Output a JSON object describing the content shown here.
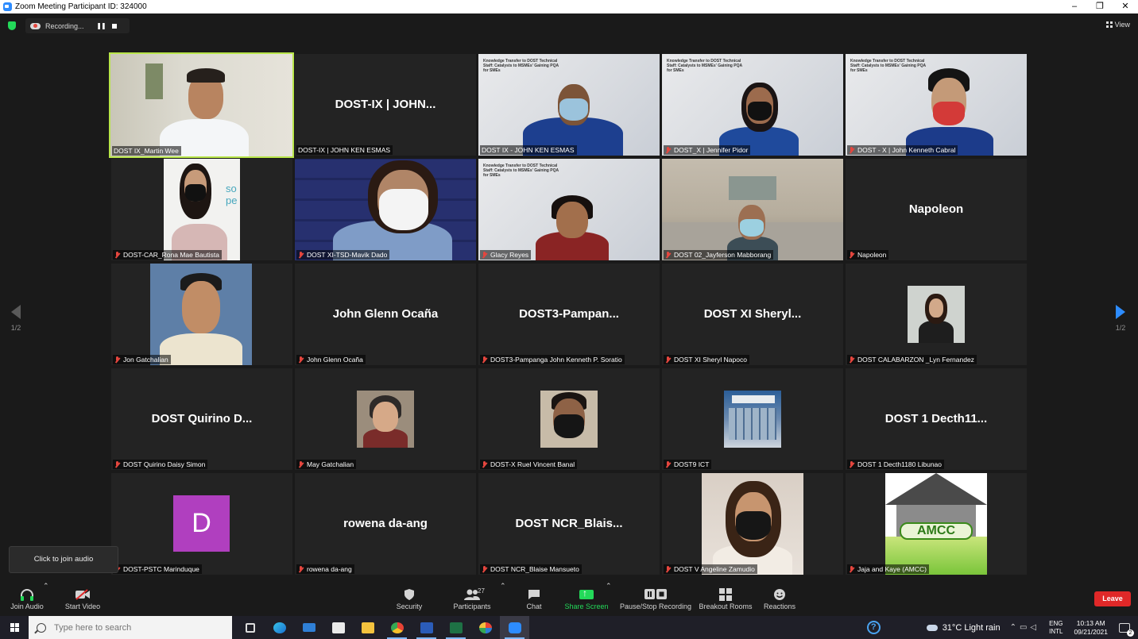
{
  "window": {
    "title": "Zoom Meeting Participant ID: 324000",
    "minimize": "–",
    "restore": "❐",
    "close": "✕"
  },
  "meeting": {
    "recording_label": "Recording...",
    "view_label": "View",
    "page_left": "1/2",
    "page_right": "1/2"
  },
  "tiles": [
    {
      "label": "DOST IX_Martin Wee",
      "bigname": ""
    },
    {
      "label": "DOST-IX | JOHN KEN ESMAS",
      "bigname": "DOST-IX | JOHN..."
    },
    {
      "label": "DOST IX - JOHN KEN ESMAS",
      "bigname": ""
    },
    {
      "label": "DOST_X | Jennifer Pidor",
      "bigname": ""
    },
    {
      "label": "DOST - X | John Kenneth Cabral",
      "bigname": ""
    },
    {
      "label": "DOST-CAR_Rona Mae Bautista",
      "bigname": ""
    },
    {
      "label": "DOST XI-TSD-Mavik Dado",
      "bigname": ""
    },
    {
      "label": "Glacy Reyes",
      "bigname": ""
    },
    {
      "label": "DOST 02_Jayferson Mabborang",
      "bigname": ""
    },
    {
      "label": "Napoleon",
      "bigname": "Napoleon"
    },
    {
      "label": "Jon Gatchalian",
      "bigname": ""
    },
    {
      "label": "John Glenn Ocaña",
      "bigname": "John Glenn Ocaña"
    },
    {
      "label": "DOST3-Pampanga John Kenneth P. Soratio",
      "bigname": "DOST3-Pampan..."
    },
    {
      "label": "DOST XI Sheryl Napoco",
      "bigname": "DOST  XI  Sheryl..."
    },
    {
      "label": "DOST CALABARZON _Lyn Fernandez",
      "bigname": ""
    },
    {
      "label": "DOST Quirino Daisy Simon",
      "bigname": "DOST  Quirino  D..."
    },
    {
      "label": "May Gatchalian",
      "bigname": ""
    },
    {
      "label": "DOST-X Ruel Vincent Banal",
      "bigname": ""
    },
    {
      "label": "DOST9 ICT",
      "bigname": ""
    },
    {
      "label": "DOST 1 Decth1180 Libunao",
      "bigname": "DOST  1  Decth11..."
    },
    {
      "label": "DOST-PSTC Marinduque",
      "bigname": ""
    },
    {
      "label": "rowena da-ang",
      "bigname": "rowena da-ang"
    },
    {
      "label": "DOST NCR_Blaise Mansueto",
      "bigname": "DOST  NCR_Blais..."
    },
    {
      "label": "DOST V Angeline Zamudio",
      "bigname": ""
    },
    {
      "label": "Jaja and Kaye (AMCC)",
      "bigname": ""
    }
  ],
  "slide_text": "Knowledge Transfer to DOST Technical Staff: Catalysts to MSMEs' Gaining PQA for SMEs",
  "avatar_letter": "D",
  "logo_text": "AMCC",
  "tooltip": "Click to join audio",
  "toolbar": {
    "join_audio": "Join Audio",
    "start_video": "Start Video",
    "security": "Security",
    "participants": "Participants",
    "participants_count": "27",
    "chat": "Chat",
    "share_screen": "Share Screen",
    "pause_recording": "Pause/Stop Recording",
    "breakout_rooms": "Breakout Rooms",
    "reactions": "Reactions",
    "leave": "Leave"
  },
  "taskbar": {
    "search_placeholder": "Type here to search",
    "weather": "31°C  Light rain",
    "lang1": "ENG",
    "lang2": "INTL",
    "time": "10:13 AM",
    "date": "09/21/2021",
    "notif_count": "2"
  },
  "colors": {
    "active_speaker": "#b8e54a",
    "share_green": "#23d959",
    "leave_red": "#e02828",
    "zoom_blue": "#2d8cff"
  }
}
